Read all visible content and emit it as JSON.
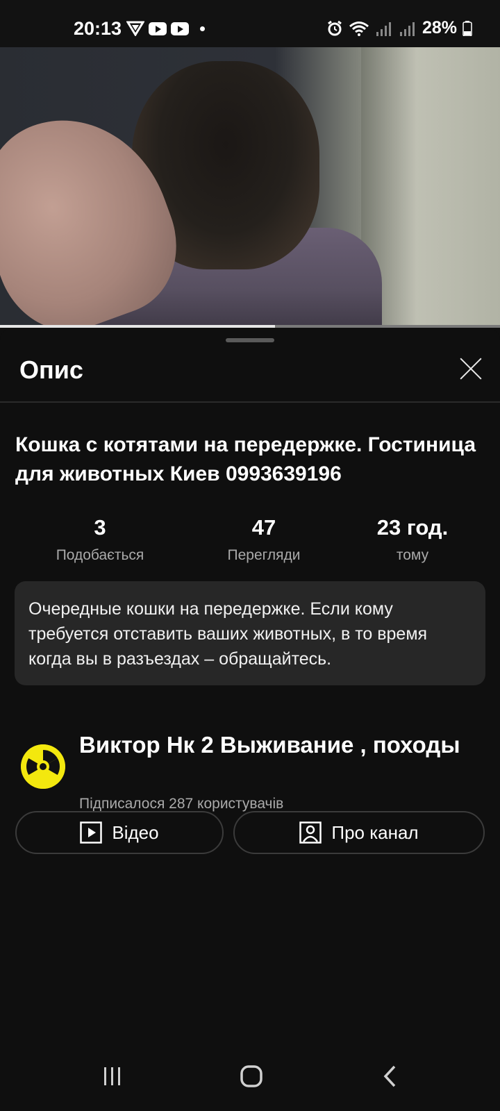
{
  "status_bar": {
    "time": "20:13",
    "battery_percent": "28%"
  },
  "video": {
    "progress_fraction": 0.55
  },
  "sheet": {
    "title": "Опис",
    "video_title": "Кошка с котятами на передержке. Гостиница для животных Киев 0993639196",
    "stats": [
      {
        "value": "3",
        "label": "Подобається"
      },
      {
        "value": "47",
        "label": "Перегляди"
      },
      {
        "value": "23 год.",
        "label": "тому"
      }
    ],
    "description": "Очередные кошки на передержке. Если кому требуется отставить ваших животных, в то время когда вы в разъездах – обращайтесь.",
    "channel": {
      "name": "Виктор Нк 2 Выживание , походы",
      "subscribers": "Підписалося 287 користувачів"
    },
    "buttons": {
      "videos": "Відео",
      "about": "Про канал"
    }
  },
  "icons": {
    "close": "close-icon",
    "play": "play-box-icon",
    "person": "person-box-icon"
  }
}
